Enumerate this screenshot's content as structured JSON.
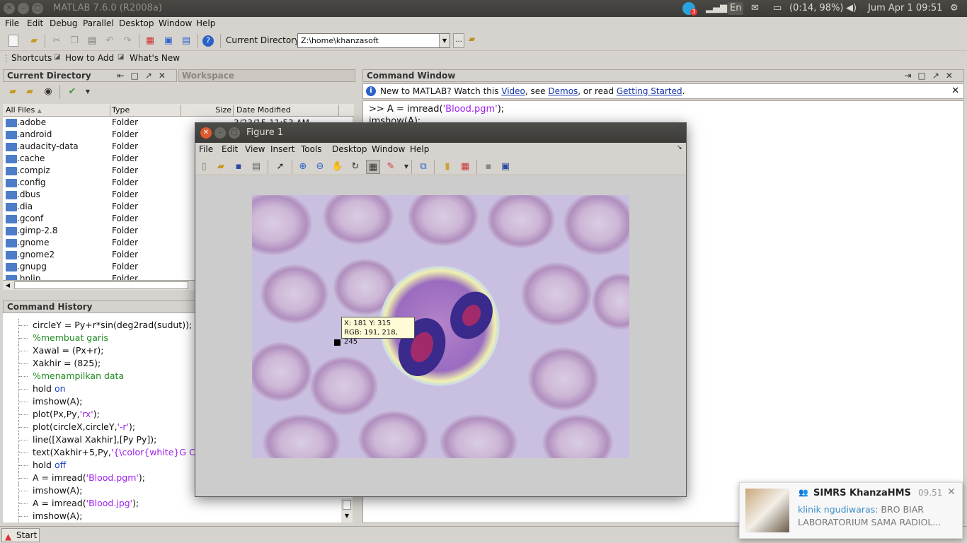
{
  "window_title": "MATLAB 7.6.0 (R2008a)",
  "tray": {
    "lang": "En",
    "battery": "(0:14, 98%)",
    "clock": "Jum Apr 1 09:51",
    "badge": "3"
  },
  "menu": [
    "File",
    "Edit",
    "Debug",
    "Parallel",
    "Desktop",
    "Window",
    "Help"
  ],
  "toolbar": {
    "current_dir_label": "Current Directory:",
    "current_dir_value": "Z:\\home\\khanzasoft",
    "browse": "..."
  },
  "shortcuts": {
    "label": "Shortcuts",
    "howto": "How to Add",
    "whatsnew": "What's New"
  },
  "current_dir": {
    "title": "Current Directory",
    "workspace_tab": "Workspace",
    "columns": {
      "name": "All Files",
      "type": "Type",
      "size": "Size",
      "modified": "Date Modified"
    },
    "first_modified": "3/23/15 11:53 AM",
    "files": [
      {
        "name": ".adobe",
        "type": "Folder"
      },
      {
        "name": ".android",
        "type": "Folder"
      },
      {
        "name": ".audacity-data",
        "type": "Folder"
      },
      {
        "name": ".cache",
        "type": "Folder"
      },
      {
        "name": ".compiz",
        "type": "Folder"
      },
      {
        "name": ".config",
        "type": "Folder"
      },
      {
        "name": ".dbus",
        "type": "Folder"
      },
      {
        "name": ".dia",
        "type": "Folder"
      },
      {
        "name": ".gconf",
        "type": "Folder"
      },
      {
        "name": ".gimp-2.8",
        "type": "Folder"
      },
      {
        "name": ".gnome",
        "type": "Folder"
      },
      {
        "name": ".gnome2",
        "type": "Folder"
      },
      {
        "name": ".gnupg",
        "type": "Folder"
      },
      {
        "name": ".hplip",
        "type": "Folder"
      }
    ]
  },
  "history": {
    "title": "Command History",
    "lines": [
      [
        {
          "t": "circleY = Py+r*sin(deg2rad(sudut));",
          "c": ""
        }
      ],
      [
        {
          "t": "%membuat garis",
          "c": "cm"
        }
      ],
      [
        {
          "t": "Xawal = (Px+r);",
          "c": ""
        }
      ],
      [
        {
          "t": "Xakhir = (825);",
          "c": ""
        }
      ],
      [
        {
          "t": "%menampilkan data",
          "c": "cm"
        }
      ],
      [
        {
          "t": "hold ",
          "c": ""
        },
        {
          "t": "on",
          "c": "kw"
        }
      ],
      [
        {
          "t": "imshow(A);",
          "c": ""
        }
      ],
      [
        {
          "t": "plot(Px,Py,",
          "c": ""
        },
        {
          "t": "'rx'",
          "c": "st"
        },
        {
          "t": ");",
          "c": ""
        }
      ],
      [
        {
          "t": "plot(circleX,circleY,",
          "c": ""
        },
        {
          "t": "'-r'",
          "c": "st"
        },
        {
          "t": ");",
          "c": ""
        }
      ],
      [
        {
          "t": "line([Xawal Xakhir],[Py Py]);",
          "c": ""
        }
      ],
      [
        {
          "t": "text(Xakhir+5,Py,",
          "c": ""
        },
        {
          "t": "'{\\color{white}G CIR",
          "c": "st"
        }
      ],
      [
        {
          "t": "hold ",
          "c": ""
        },
        {
          "t": "off",
          "c": "kw"
        }
      ],
      [
        {
          "t": "A = imread(",
          "c": ""
        },
        {
          "t": "'Blood.pgm'",
          "c": "st"
        },
        {
          "t": ");",
          "c": ""
        }
      ],
      [
        {
          "t": "imshow(A);",
          "c": ""
        }
      ],
      [
        {
          "t": "A = imread(",
          "c": ""
        },
        {
          "t": "'Blood.jpg'",
          "c": "st"
        },
        {
          "t": ");",
          "c": ""
        }
      ],
      [
        {
          "t": "imshow(A);",
          "c": ""
        }
      ]
    ]
  },
  "command_window": {
    "title": "Command Window",
    "info": {
      "pre": "New to MATLAB? Watch this ",
      "video": "Video",
      "mid1": ", see ",
      "demos": "Demos",
      "mid2": ", or read ",
      "gs": "Getting Started",
      "end": "."
    },
    "line1_prompt": ">> A = imread(",
    "line1_str": "'Blood.pgm'",
    "line1_end": ");",
    "line2": "imshow(A);"
  },
  "figure": {
    "title": "Figure 1",
    "menu": [
      "File",
      "Edit",
      "View",
      "Insert",
      "Tools",
      "Desktop",
      "Window",
      "Help"
    ],
    "datatip_line1": "X: 181 Y: 315",
    "datatip_line2": "RGB: 191, 218, 245"
  },
  "start": "Start",
  "notification": {
    "app": "SIMRS KhanzaHMS",
    "time": "09.51",
    "sender": "klinik ngudiwaras",
    "message": ": BRO BIAR LABORATORIUM SAMA RADIOL..."
  }
}
